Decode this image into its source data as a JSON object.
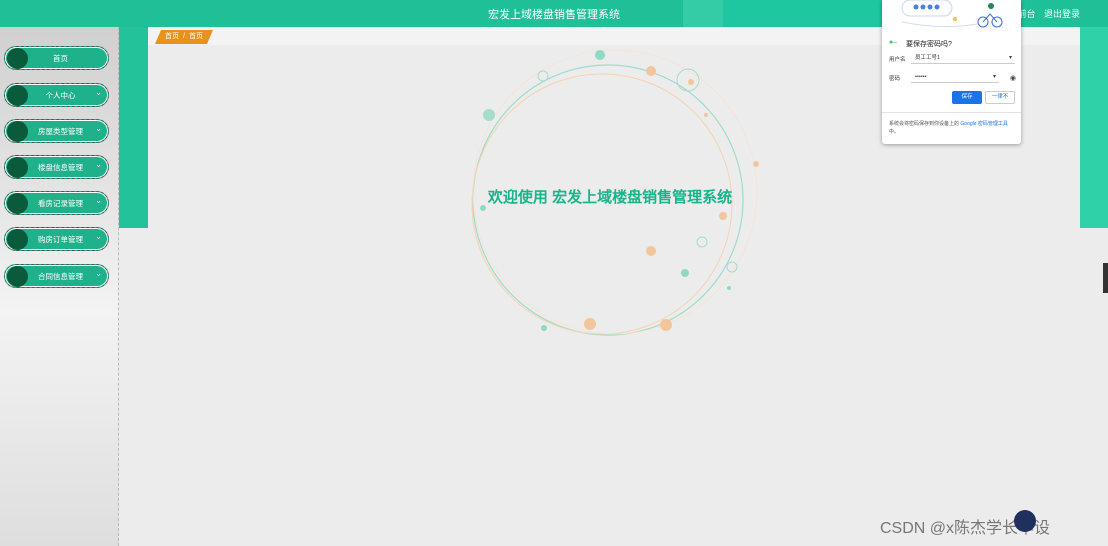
{
  "header": {
    "title": "宏发上域楼盘销售管理系统",
    "links": [
      "前台",
      "退出登录"
    ]
  },
  "breadcrumb": {
    "home": "首页",
    "separator": "/",
    "current": "首页"
  },
  "sidebar": {
    "items": [
      {
        "label": "首页",
        "has_children": false
      },
      {
        "label": "个人中心",
        "has_children": true
      },
      {
        "label": "房屋类型管理",
        "has_children": true
      },
      {
        "label": "楼盘信息管理",
        "has_children": true
      },
      {
        "label": "看房记录管理",
        "has_children": true
      },
      {
        "label": "购房订单管理",
        "has_children": true
      },
      {
        "label": "合同信息管理",
        "has_children": true
      }
    ]
  },
  "main": {
    "welcome": "欢迎使用 宏发上域楼盘销售管理系统"
  },
  "password_popup": {
    "title": "要保存密码吗?",
    "username_label": "用户名",
    "username_value": "员工工号1",
    "password_label": "密码",
    "password_value": "••••••",
    "save_label": "保存",
    "never_label": "一律不",
    "footer_text": "系统会将密码保存到你设备上的",
    "footer_link": "Google 密码管理工具",
    "footer_end": "中。"
  },
  "watermark": "CSDN @x陈杰学长毕设",
  "colors": {
    "primary": "#1fbf98",
    "menu": "#1fb18a",
    "breadcrumb": "#e8921c",
    "welcome": "#19b48b"
  }
}
